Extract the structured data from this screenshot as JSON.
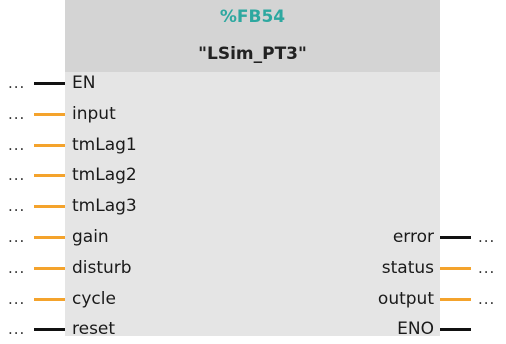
{
  "block": {
    "instance_number": "%FB54",
    "name": "\"LSim_PT3\"",
    "colors": {
      "body": "#e5e5e5",
      "header": "#d4d4d4",
      "instance_number": "#2ea8a0",
      "bool_wire": "#111111",
      "value_wire": "#f4a32c"
    }
  },
  "inputs": [
    {
      "label": "EN",
      "connection": "...",
      "wire": "bool"
    },
    {
      "label": "input",
      "connection": "...",
      "wire": "value"
    },
    {
      "label": "tmLag1",
      "connection": "...",
      "wire": "value"
    },
    {
      "label": "tmLag2",
      "connection": "...",
      "wire": "value"
    },
    {
      "label": "tmLag3",
      "connection": "...",
      "wire": "value"
    },
    {
      "label": "gain",
      "connection": "...",
      "wire": "value"
    },
    {
      "label": "disturb",
      "connection": "...",
      "wire": "value"
    },
    {
      "label": "cycle",
      "connection": "...",
      "wire": "value"
    },
    {
      "label": "reset",
      "connection": "...",
      "wire": "bool"
    }
  ],
  "outputs": [
    {
      "label": "error",
      "connection": "...",
      "wire": "bool"
    },
    {
      "label": "status",
      "connection": "...",
      "wire": "value"
    },
    {
      "label": "output",
      "connection": "...",
      "wire": "value"
    },
    {
      "label": "ENO",
      "connection": "",
      "wire": "bool"
    }
  ]
}
